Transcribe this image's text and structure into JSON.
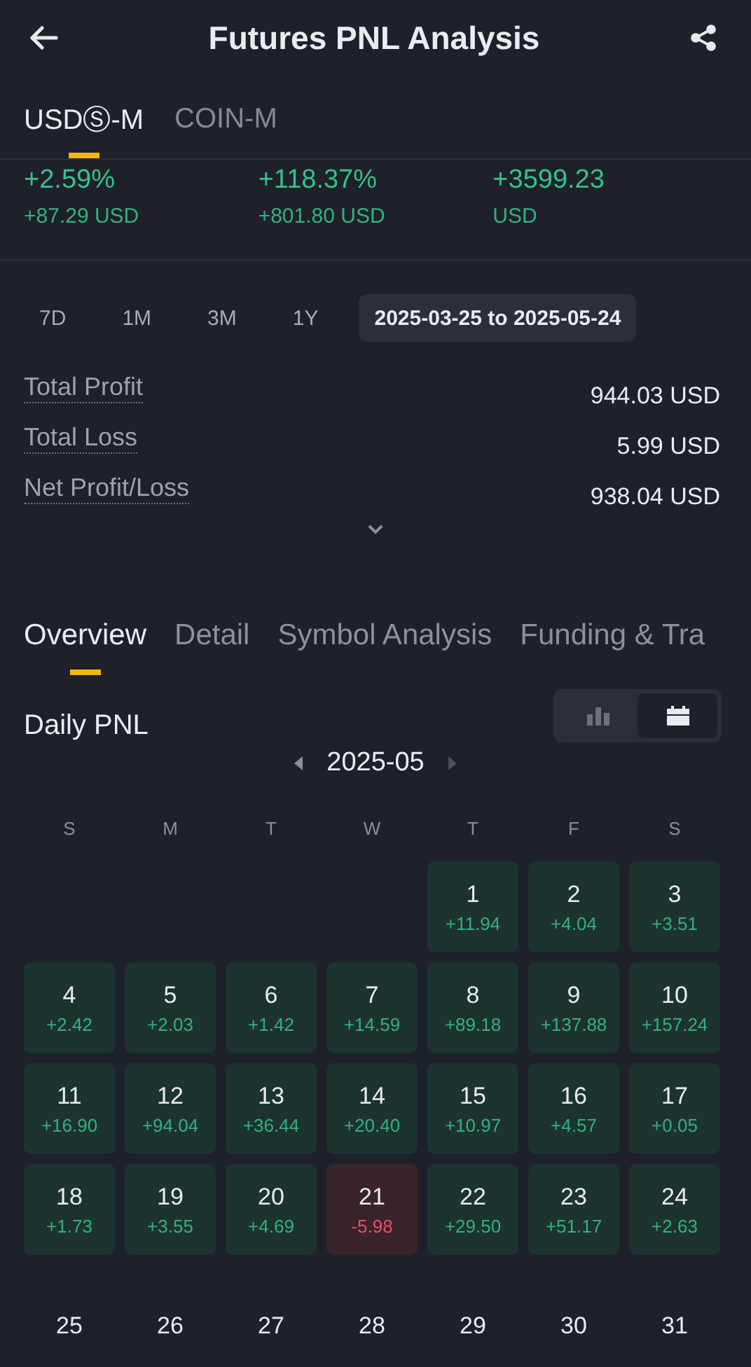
{
  "header": {
    "title": "Futures PNL Analysis"
  },
  "market_tabs": [
    {
      "label": "USDⓈ-M",
      "selected": true
    },
    {
      "label": "COIN-M",
      "selected": false
    }
  ],
  "stats": [
    {
      "value": "+2.59%",
      "sub": "+87.29 USD"
    },
    {
      "value": "+118.37%",
      "sub": "+801.80 USD"
    },
    {
      "value": "+3599.23",
      "sub": "USD"
    }
  ],
  "periods": [
    {
      "label": "7D",
      "selected": false
    },
    {
      "label": "1M",
      "selected": false
    },
    {
      "label": "3M",
      "selected": false
    },
    {
      "label": "1Y",
      "selected": false
    },
    {
      "label": "2025-03-25 to 2025-05-24",
      "selected": true
    }
  ],
  "summary": [
    {
      "label": "Total Profit",
      "value": "944.03 USD"
    },
    {
      "label": "Total Loss",
      "value": "5.99 USD"
    },
    {
      "label": "Net Profit/Loss",
      "value": "938.04 USD"
    }
  ],
  "section_tabs": [
    {
      "label": "Overview",
      "selected": true
    },
    {
      "label": "Detail",
      "selected": false
    },
    {
      "label": "Symbol Analysis",
      "selected": false
    },
    {
      "label": "Funding & Tra",
      "selected": false
    }
  ],
  "daily_pnl": {
    "title": "Daily PNL",
    "views": [
      {
        "kind": "chart",
        "selected": false
      },
      {
        "kind": "calendar",
        "selected": true
      }
    ],
    "month": "2025-05",
    "weekdays": [
      "S",
      "M",
      "T",
      "W",
      "T",
      "F",
      "S"
    ],
    "days": [
      {
        "day": "1",
        "pnl": "+11.94",
        "kind": "profit"
      },
      {
        "day": "2",
        "pnl": "+4.04",
        "kind": "profit"
      },
      {
        "day": "3",
        "pnl": "+3.51",
        "kind": "profit"
      },
      {
        "day": "4",
        "pnl": "+2.42",
        "kind": "profit"
      },
      {
        "day": "5",
        "pnl": "+2.03",
        "kind": "profit"
      },
      {
        "day": "6",
        "pnl": "+1.42",
        "kind": "profit"
      },
      {
        "day": "7",
        "pnl": "+14.59",
        "kind": "profit"
      },
      {
        "day": "8",
        "pnl": "+89.18",
        "kind": "profit"
      },
      {
        "day": "9",
        "pnl": "+137.88",
        "kind": "profit"
      },
      {
        "day": "10",
        "pnl": "+157.24",
        "kind": "profit"
      },
      {
        "day": "11",
        "pnl": "+16.90",
        "kind": "profit"
      },
      {
        "day": "12",
        "pnl": "+94.04",
        "kind": "profit"
      },
      {
        "day": "13",
        "pnl": "+36.44",
        "kind": "profit"
      },
      {
        "day": "14",
        "pnl": "+20.40",
        "kind": "profit"
      },
      {
        "day": "15",
        "pnl": "+10.97",
        "kind": "profit"
      },
      {
        "day": "16",
        "pnl": "+4.57",
        "kind": "profit"
      },
      {
        "day": "17",
        "pnl": "+0.05",
        "kind": "profit"
      },
      {
        "day": "18",
        "pnl": "+1.73",
        "kind": "profit"
      },
      {
        "day": "19",
        "pnl": "+3.55",
        "kind": "profit"
      },
      {
        "day": "20",
        "pnl": "+4.69",
        "kind": "profit"
      },
      {
        "day": "21",
        "pnl": "-5.98",
        "kind": "loss"
      },
      {
        "day": "22",
        "pnl": "+29.50",
        "kind": "profit"
      },
      {
        "day": "23",
        "pnl": "+51.17",
        "kind": "profit"
      },
      {
        "day": "24",
        "pnl": "+2.63",
        "kind": "profit"
      },
      {
        "day": "25",
        "kind": "none"
      },
      {
        "day": "26",
        "kind": "none"
      },
      {
        "day": "27",
        "kind": "none"
      },
      {
        "day": "28",
        "kind": "none"
      },
      {
        "day": "29",
        "kind": "none"
      },
      {
        "day": "30",
        "kind": "none"
      },
      {
        "day": "31",
        "kind": "none"
      }
    ]
  }
}
